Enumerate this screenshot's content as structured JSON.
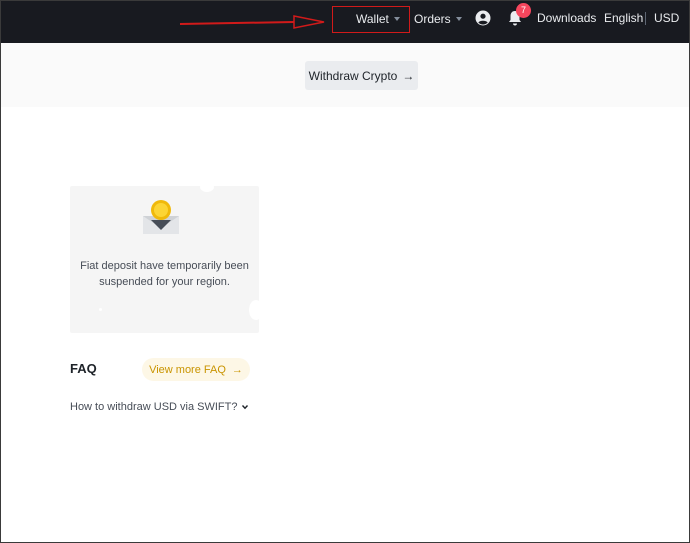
{
  "topbar": {
    "wallet_label": "Wallet",
    "orders_label": "Orders",
    "notification_count": "7",
    "downloads_label": "Downloads",
    "language_label": "English",
    "currency_label": "USD"
  },
  "hero": {
    "withdraw_button_label": "Withdraw Crypto",
    "withdraw_arrow": "→"
  },
  "card": {
    "message": "Fiat deposit have temporarily been suspended for your region."
  },
  "faq": {
    "title": "FAQ",
    "view_more_label": "View more FAQ",
    "view_more_arrow": "→",
    "items": [
      {
        "question": "How to withdraw USD via SWIFT?"
      }
    ]
  },
  "colors": {
    "topbar_bg": "#181a20",
    "accent": "#c99400",
    "badge": "#f6465d",
    "annotation": "#d11a1a"
  },
  "icons": {
    "user": "user-circle-icon",
    "bell": "bell-icon",
    "wallet_caret": "caret-down-icon",
    "orders_caret": "caret-down-icon",
    "withdraw_arrow": "arrow-right-icon",
    "faq_chevron": "chevron-down-icon",
    "card_illustration": "coin-inbox-icon"
  }
}
